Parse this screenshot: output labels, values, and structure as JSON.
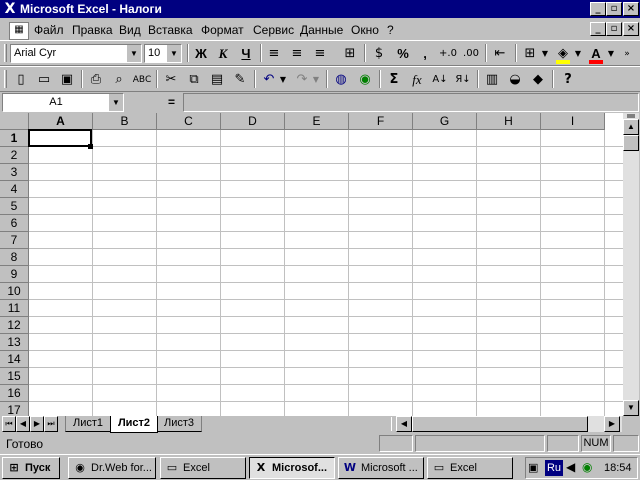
{
  "window": {
    "title": "Microsoft Excel - Налоги"
  },
  "menu": [
    "Файл",
    "Правка",
    "Вид",
    "Вставка",
    "Формат",
    "Сервис",
    "Данные",
    "Окно",
    "?"
  ],
  "format_toolbar": {
    "font_name": "Arial Cyr",
    "font_size": "10",
    "bold": "Ж",
    "italic": "К",
    "underline": "Ч",
    "percent": "%",
    "comma": ","
  },
  "standard_toolbar": {
    "sum": "Σ",
    "fx": "fx"
  },
  "formula_bar": {
    "name_box": "A1",
    "equals": "=",
    "value": ""
  },
  "grid": {
    "columns": [
      "A",
      "B",
      "C",
      "D",
      "E",
      "F",
      "G",
      "H",
      "I"
    ],
    "rows": [
      "1",
      "2",
      "3",
      "4",
      "5",
      "6",
      "7",
      "8",
      "9",
      "10",
      "11",
      "12",
      "13",
      "14",
      "15",
      "16",
      "17"
    ],
    "active_cell": "A1"
  },
  "sheet_tabs": [
    "Лист1",
    "Лист2",
    "Лист3"
  ],
  "active_sheet": "Лист2",
  "status": {
    "text": "Готово",
    "num": "NUM"
  },
  "taskbar": {
    "start": "Пуск",
    "buttons": [
      "Dr.Web for...",
      "Excel",
      "Microsof...",
      "Microsoft ...",
      "Excel"
    ],
    "active_index": 2,
    "lang": "Ru",
    "clock": "18:54"
  },
  "colors": {
    "title_bar": "#000080",
    "face": "#c0c0c0",
    "grid_line": "#c0c0c0"
  }
}
